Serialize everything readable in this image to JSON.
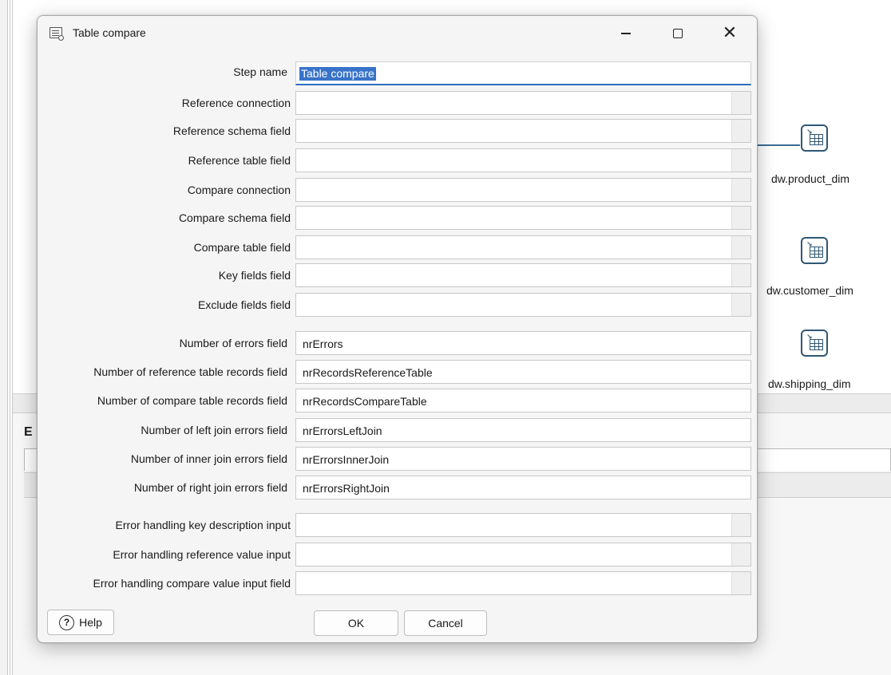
{
  "dialog": {
    "title": "Table compare",
    "minimize_icon": "minimize-icon",
    "maximize_icon": "maximize-icon",
    "close_icon": "close-icon",
    "close_glyph": "✕"
  },
  "form": {
    "step_name": {
      "label": "Step name",
      "value": "Table compare"
    },
    "fields": [
      {
        "label": "Reference connection",
        "value": ""
      },
      {
        "label": "Reference schema field",
        "value": ""
      },
      {
        "label": "Reference table field",
        "value": ""
      },
      {
        "label": "Compare connection",
        "value": ""
      },
      {
        "label": "Compare schema field",
        "value": ""
      },
      {
        "label": "Compare table field",
        "value": ""
      },
      {
        "label": "Key fields field",
        "value": ""
      },
      {
        "label": "Exclude fields field",
        "value": ""
      }
    ],
    "output_fields": [
      {
        "label": "Number of errors field",
        "value": "nrErrors"
      },
      {
        "label": "Number of reference table records field",
        "value": "nrRecordsReferenceTable"
      },
      {
        "label": "Number of compare table records field",
        "value": "nrRecordsCompareTable"
      },
      {
        "label": "Number of left join errors field",
        "value": "nrErrorsLeftJoin"
      },
      {
        "label": "Number of inner join errors field",
        "value": "nrErrorsInnerJoin"
      },
      {
        "label": "Number of right join errors field",
        "value": "nrErrorsRightJoin"
      }
    ],
    "error_fields": [
      {
        "label": "Error handling key description input",
        "value": ""
      },
      {
        "label": "Error handling reference value input",
        "value": ""
      },
      {
        "label": "Error handling compare value input field",
        "value": ""
      }
    ]
  },
  "buttons": {
    "help": "Help",
    "help_glyph": "?",
    "ok": "OK",
    "cancel": "Cancel"
  },
  "background": {
    "panel_letter": "E",
    "steps": [
      {
        "label": "dw.product_dim",
        "icon": "table-output-icon"
      },
      {
        "label": "dw.customer_dim",
        "icon": "table-output-icon"
      },
      {
        "label": "dw.shipping_dim",
        "icon": "table-output-icon"
      }
    ]
  },
  "colors": {
    "selection": "#3873c9",
    "focus_border": "#2b6ec2",
    "step_icon": "#2f5775"
  }
}
